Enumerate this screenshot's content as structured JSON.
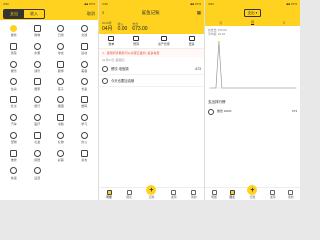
{
  "panel1": {
    "status_left": "4:52",
    "status_right": "■■ 97%",
    "tabs": [
      "支出",
      "收入"
    ],
    "active_tab": 0,
    "cancel_label": "取消",
    "categories": [
      {
        "label": "餐饮",
        "icon": "utensils-icon",
        "selected": true
      },
      {
        "label": "购物",
        "icon": "cart-icon"
      },
      {
        "label": "日用",
        "icon": "daily-icon"
      },
      {
        "label": "交通",
        "icon": "bus-icon"
      },
      {
        "label": "蔬菜",
        "icon": "vegetable-icon"
      },
      {
        "label": "水果",
        "icon": "fruit-icon"
      },
      {
        "label": "零食",
        "icon": "snack-icon"
      },
      {
        "label": "运动",
        "icon": "bike-icon"
      },
      {
        "label": "娱乐",
        "icon": "game-icon"
      },
      {
        "label": "通讯",
        "icon": "phone-icon"
      },
      {
        "label": "服饰",
        "icon": "shirt-icon"
      },
      {
        "label": "美容",
        "icon": "beauty-icon"
      },
      {
        "label": "住房",
        "icon": "house-icon"
      },
      {
        "label": "居家",
        "icon": "sofa-icon"
      },
      {
        "label": "孩子",
        "icon": "baby-icon"
      },
      {
        "label": "长辈",
        "icon": "elder-icon"
      },
      {
        "label": "社交",
        "icon": "social-icon"
      },
      {
        "label": "旅行",
        "icon": "plane-icon"
      },
      {
        "label": "烟酒",
        "icon": "wine-icon"
      },
      {
        "label": "数码",
        "icon": "digital-icon"
      },
      {
        "label": "汽车",
        "icon": "car-icon"
      },
      {
        "label": "医疗",
        "icon": "medical-icon"
      },
      {
        "label": "书籍",
        "icon": "book-icon"
      },
      {
        "label": "学习",
        "icon": "study-icon"
      },
      {
        "label": "宠物",
        "icon": "pet-icon"
      },
      {
        "label": "礼金",
        "icon": "gift-icon"
      },
      {
        "label": "礼物",
        "icon": "present-icon"
      },
      {
        "label": "办公",
        "icon": "office-icon"
      },
      {
        "label": "维修",
        "icon": "repair-icon"
      },
      {
        "label": "捐赠",
        "icon": "donate-icon"
      },
      {
        "label": "彩票",
        "icon": "lottery-icon"
      },
      {
        "label": "亲友",
        "icon": "friends-icon"
      },
      {
        "label": "快递",
        "icon": "express-icon"
      },
      {
        "label": "设置",
        "icon": "settings-icon"
      }
    ]
  },
  "panel2": {
    "status_left": "4:52",
    "status_right": "■■ 97%",
    "title": "鲨鱼记账",
    "summary": {
      "year": "2019年",
      "month": "04月",
      "income_label": "收入",
      "income_value": "0.00",
      "expense_label": "支出",
      "expense_value": "673.00"
    },
    "tools": [
      {
        "label": "账单",
        "icon": "bill-icon"
      },
      {
        "label": "预算",
        "icon": "budget-icon"
      },
      {
        "label": "资产管家",
        "icon": "asset-icon"
      },
      {
        "label": "更多",
        "icon": "more-icon"
      }
    ],
    "notice": "使用同步服务可以享受云备份, 最多免费",
    "date_line": "04月04日 星期四",
    "records": [
      {
        "label": "餐饮-电饭锅",
        "value": "-673"
      },
      {
        "label": "今天也要加油哦",
        "value": ""
      }
    ],
    "nav": [
      {
        "label": "明细",
        "icon": "list-icon",
        "active": true
      },
      {
        "label": "图表",
        "icon": "chart-icon"
      },
      {
        "label": "记账",
        "plus": true
      },
      {
        "label": "发现",
        "icon": "discover-icon"
      },
      {
        "label": "我的",
        "icon": "profile-icon"
      }
    ]
  },
  "panel3": {
    "status_left": "4:52",
    "status_right": "■■ 97%",
    "dropdown": "支出 ▾",
    "tabs": [
      "周",
      "月",
      "年"
    ],
    "active_tab": 1,
    "meta_lines": [
      "总支出: 673.00",
      "平均值: 22.43"
    ],
    "section_title": "支出排行榜",
    "ranking": [
      {
        "label": "餐饮 100%",
        "value": "673",
        "icon": "utensils-icon"
      }
    ],
    "nav": [
      {
        "label": "明细",
        "icon": "list-icon"
      },
      {
        "label": "图表",
        "icon": "chart-icon",
        "active": true
      },
      {
        "label": "记账",
        "plus": true
      },
      {
        "label": "发现",
        "icon": "discover-icon"
      },
      {
        "label": "我的",
        "icon": "profile-icon"
      }
    ]
  },
  "chart_data": {
    "type": "line",
    "x": [
      1,
      2,
      3,
      4,
      5,
      6,
      7,
      8,
      9,
      10,
      11,
      12,
      13,
      14,
      15,
      16,
      17,
      18,
      19,
      20,
      21,
      22,
      23,
      24,
      25,
      26,
      27,
      28,
      29,
      30
    ],
    "series": [
      {
        "values": [
          0,
          0,
          0,
          673,
          0,
          0,
          0,
          0,
          0,
          0,
          0,
          0,
          0,
          0,
          0,
          0,
          0,
          0,
          0,
          0,
          0,
          0,
          0,
          0,
          0,
          0,
          0,
          0,
          0,
          0
        ]
      }
    ],
    "title": "",
    "xlabel": "",
    "ylabel": "",
    "ylim": [
      0,
      700
    ],
    "colors": {
      "line": "#888888",
      "accent": "#ffd21f"
    }
  }
}
